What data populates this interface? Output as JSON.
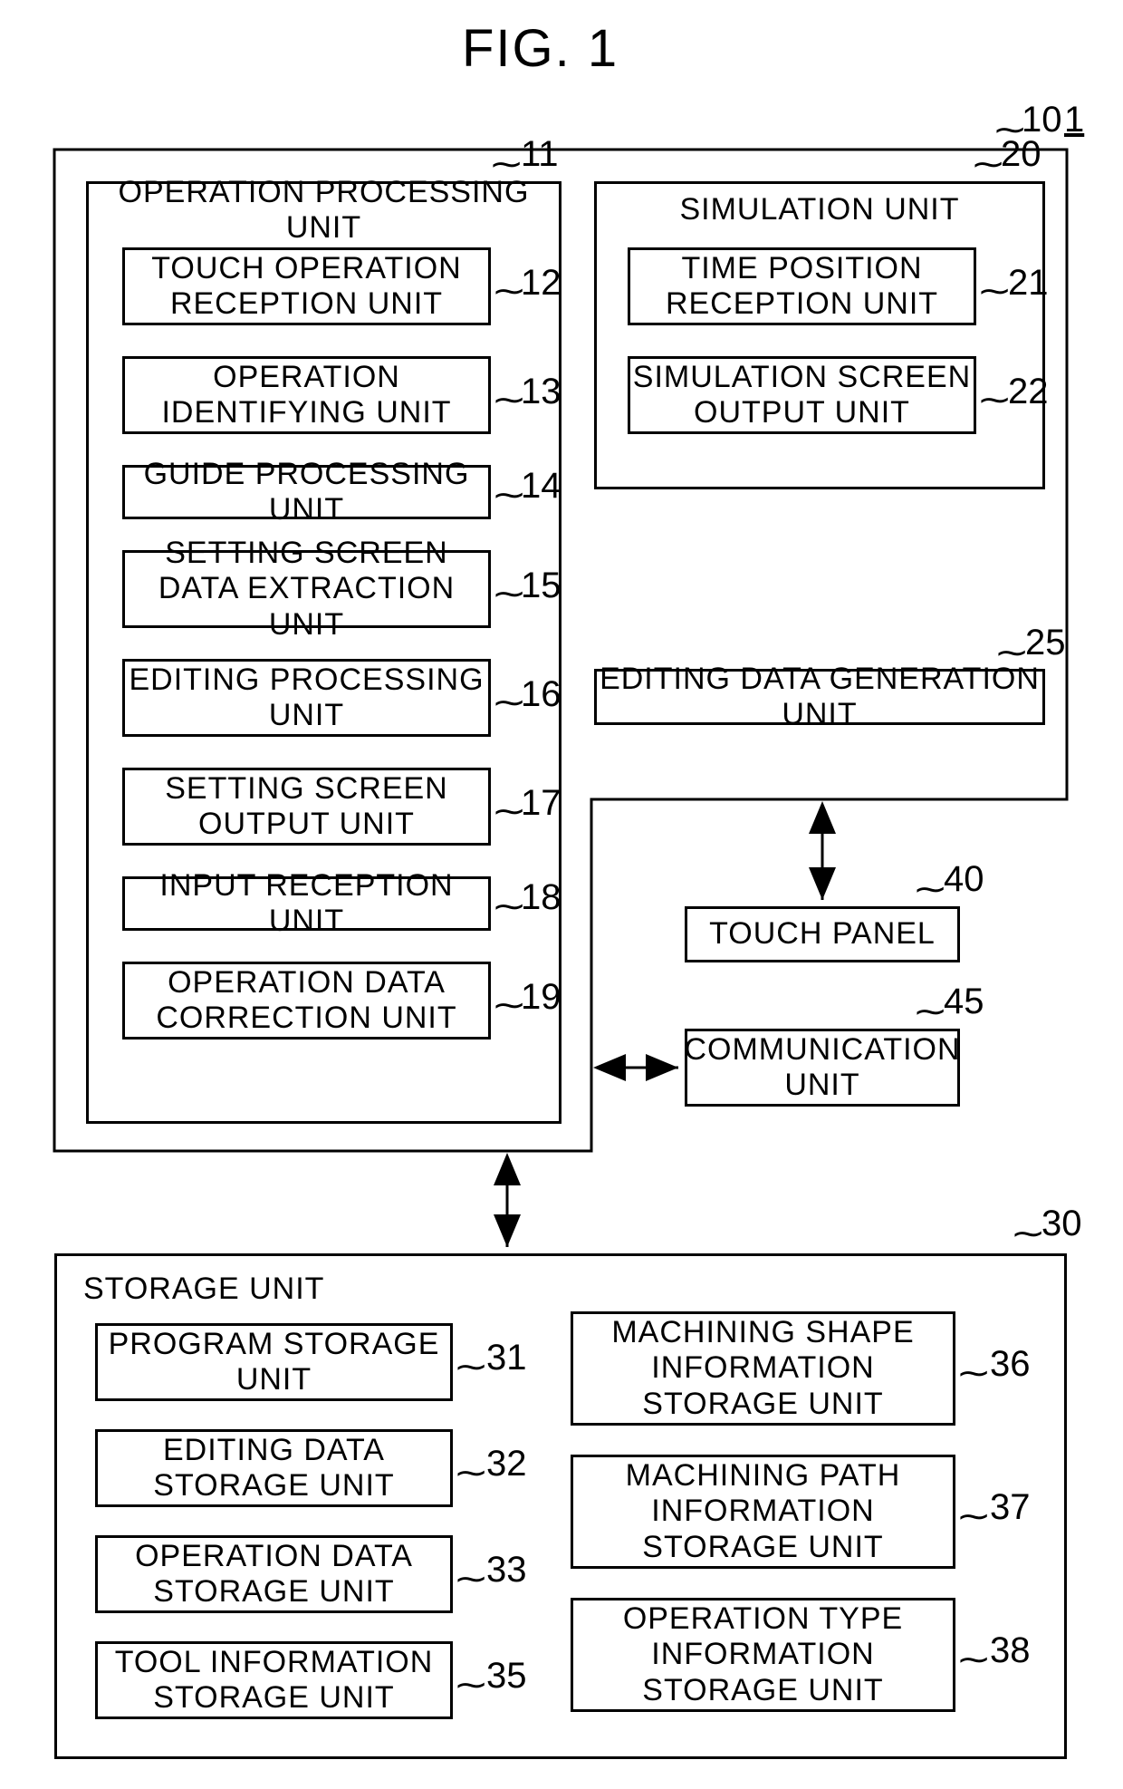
{
  "figure_title": "FIG. 1",
  "system_ref": "1",
  "box10": {
    "ref": "10"
  },
  "box11": {
    "title": "OPERATION PROCESSING UNIT",
    "ref": "11"
  },
  "u12": {
    "label": "TOUCH OPERATION RECEPTION UNIT",
    "ref": "12"
  },
  "u13": {
    "label": "OPERATION IDENTIFYING UNIT",
    "ref": "13"
  },
  "u14": {
    "label": "GUIDE PROCESSING UNIT",
    "ref": "14"
  },
  "u15": {
    "label": "SETTING SCREEN DATA EXTRACTION UNIT",
    "ref": "15"
  },
  "u16": {
    "label": "EDITING PROCESSING UNIT",
    "ref": "16"
  },
  "u17": {
    "label": "SETTING SCREEN OUTPUT UNIT",
    "ref": "17"
  },
  "u18": {
    "label": "INPUT RECEPTION UNIT",
    "ref": "18"
  },
  "u19": {
    "label": "OPERATION DATA CORRECTION UNIT",
    "ref": "19"
  },
  "box20": {
    "title": "SIMULATION UNIT",
    "ref": "20"
  },
  "u21": {
    "label": "TIME POSITION RECEPTION UNIT",
    "ref": "21"
  },
  "u22": {
    "label": "SIMULATION SCREEN OUTPUT UNIT",
    "ref": "22"
  },
  "u25": {
    "label": "EDITING DATA GENERATION UNIT",
    "ref": "25"
  },
  "box30": {
    "title": "STORAGE UNIT",
    "ref": "30"
  },
  "u31": {
    "label": "PROGRAM STORAGE UNIT",
    "ref": "31"
  },
  "u32": {
    "label": "EDITING DATA STORAGE UNIT",
    "ref": "32"
  },
  "u33": {
    "label": "OPERATION DATA STORAGE UNIT",
    "ref": "33"
  },
  "u35": {
    "label": "TOOL INFORMATION STORAGE UNIT",
    "ref": "35"
  },
  "u36": {
    "label": "MACHINING SHAPE INFORMATION STORAGE UNIT",
    "ref": "36"
  },
  "u37": {
    "label": "MACHINING PATH INFORMATION STORAGE UNIT",
    "ref": "37"
  },
  "u38": {
    "label": "OPERATION TYPE INFORMATION STORAGE UNIT",
    "ref": "38"
  },
  "u40": {
    "label": "TOUCH PANEL",
    "ref": "40"
  },
  "u45": {
    "label": "COMMUNICATION UNIT",
    "ref": "45"
  }
}
